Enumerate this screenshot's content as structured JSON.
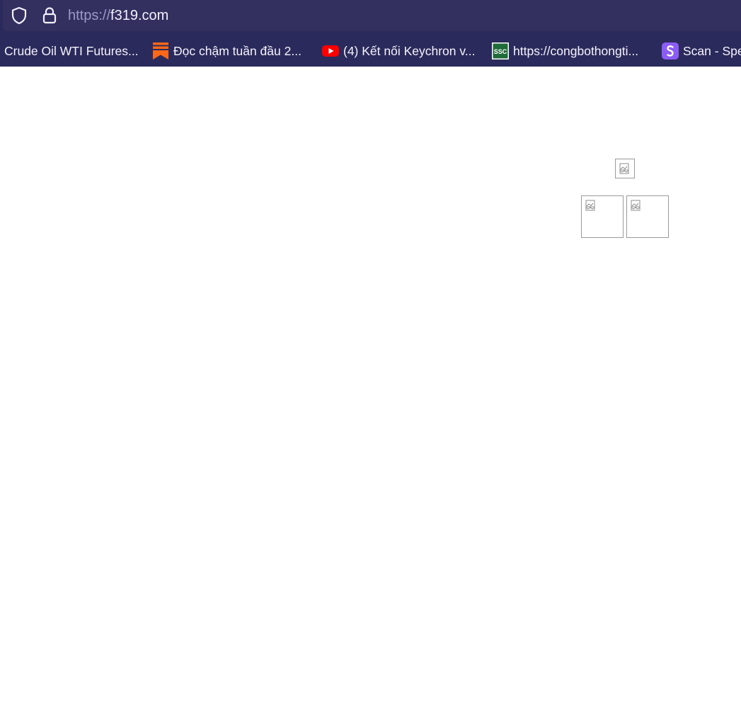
{
  "browser": {
    "url": {
      "scheme": "https://",
      "host": "f319.com"
    },
    "bookmarks": [
      {
        "label": "Crude Oil WTI Futures...",
        "icon": "none"
      },
      {
        "label": "Đọc chậm tuần đầu 2...",
        "icon": "substack-icon"
      },
      {
        "label": "(4) Kết nối Keychron v...",
        "icon": "youtube-icon"
      },
      {
        "label": "https://congbothongti...",
        "icon": "ssc-icon"
      },
      {
        "label": "Scan - Spe",
        "icon": "scan-app-icon"
      }
    ],
    "icons": {
      "tracking_protection": "shield-icon",
      "secure_connection": "lock-icon"
    },
    "colors": {
      "toolbar": "#2b2a5c",
      "urlbar": "#33305f",
      "substack": "#ff6719",
      "youtube": "#ff0000",
      "ssc": "#1f6b3a",
      "scan_app": "#8b5cf6"
    }
  },
  "page": {
    "broken_images": [
      {
        "name": "broken-image-top",
        "icon": "broken-image-icon"
      },
      {
        "name": "broken-image-left",
        "icon": "broken-image-icon"
      },
      {
        "name": "broken-image-right",
        "icon": "broken-image-icon"
      }
    ]
  }
}
